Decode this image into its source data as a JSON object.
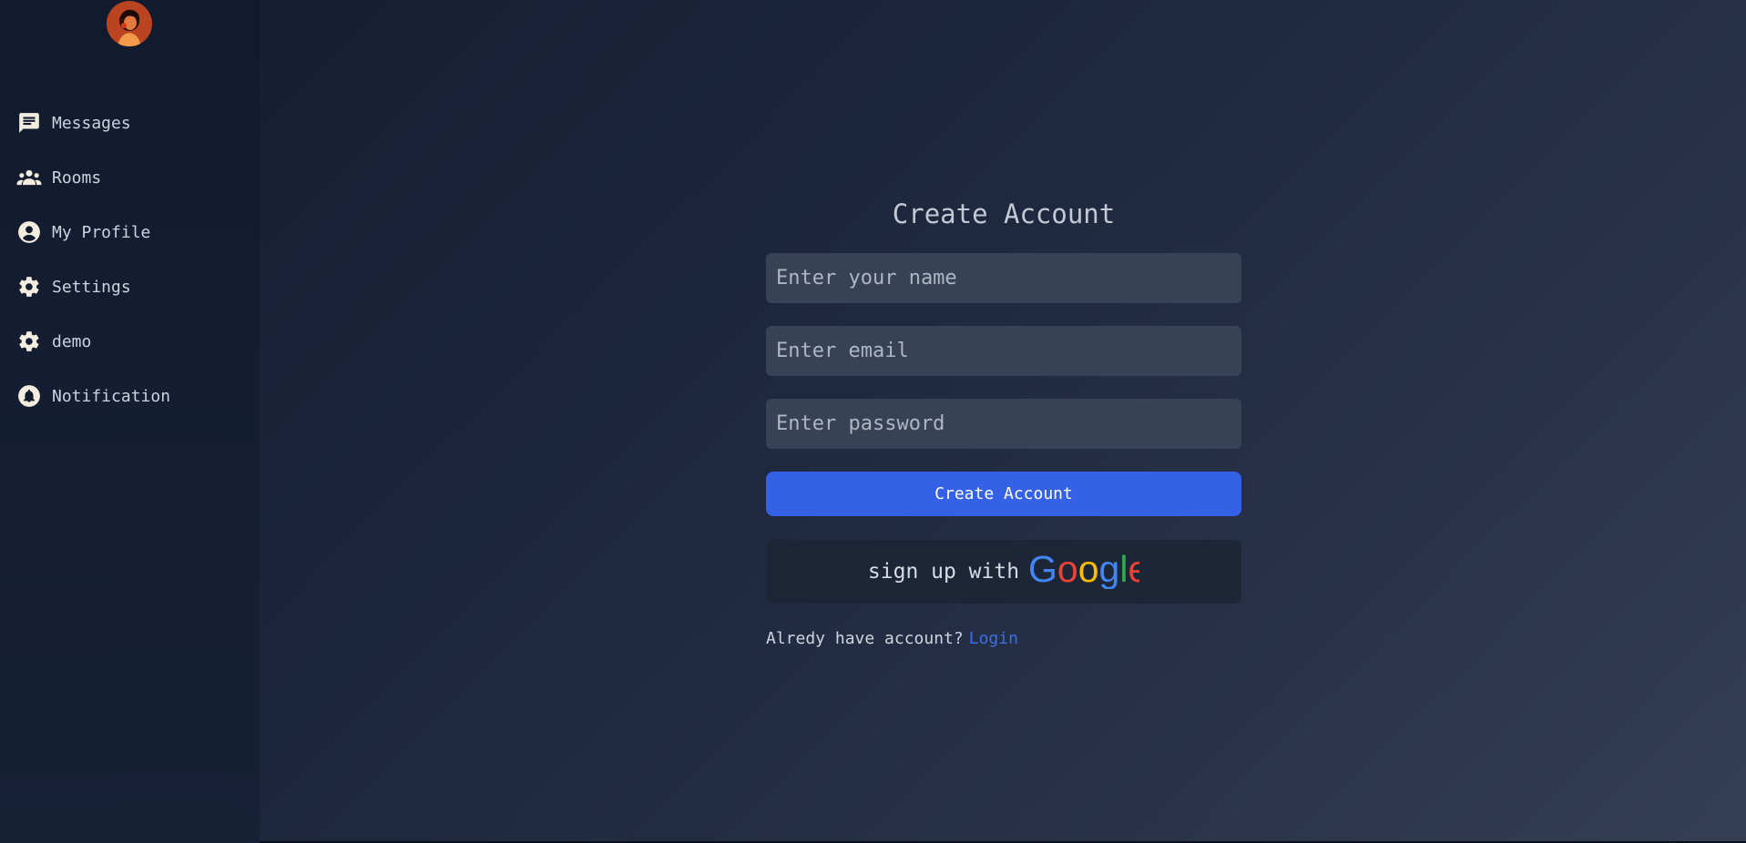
{
  "sidebar": {
    "items": [
      {
        "label": "Messages",
        "icon": "message-icon"
      },
      {
        "label": "Rooms",
        "icon": "group-icon"
      },
      {
        "label": "My Profile",
        "icon": "profile-icon"
      },
      {
        "label": "Settings",
        "icon": "gear-icon"
      },
      {
        "label": "demo",
        "icon": "gear-icon"
      },
      {
        "label": "Notification",
        "icon": "bell-icon"
      }
    ]
  },
  "form": {
    "title": "Create Account",
    "name_placeholder": "Enter your name",
    "email_placeholder": "Enter email",
    "password_placeholder": "Enter password",
    "submit_label": "Create Account",
    "google_prefix": "sign up with",
    "google_brand": "Google",
    "login_prompt": "Alredy have account?",
    "login_link": "Login"
  },
  "colors": {
    "accent": "#3561e6",
    "link": "#3b6ff0",
    "input_bg": "#374256",
    "sidebar_bg": "#121a2d"
  }
}
